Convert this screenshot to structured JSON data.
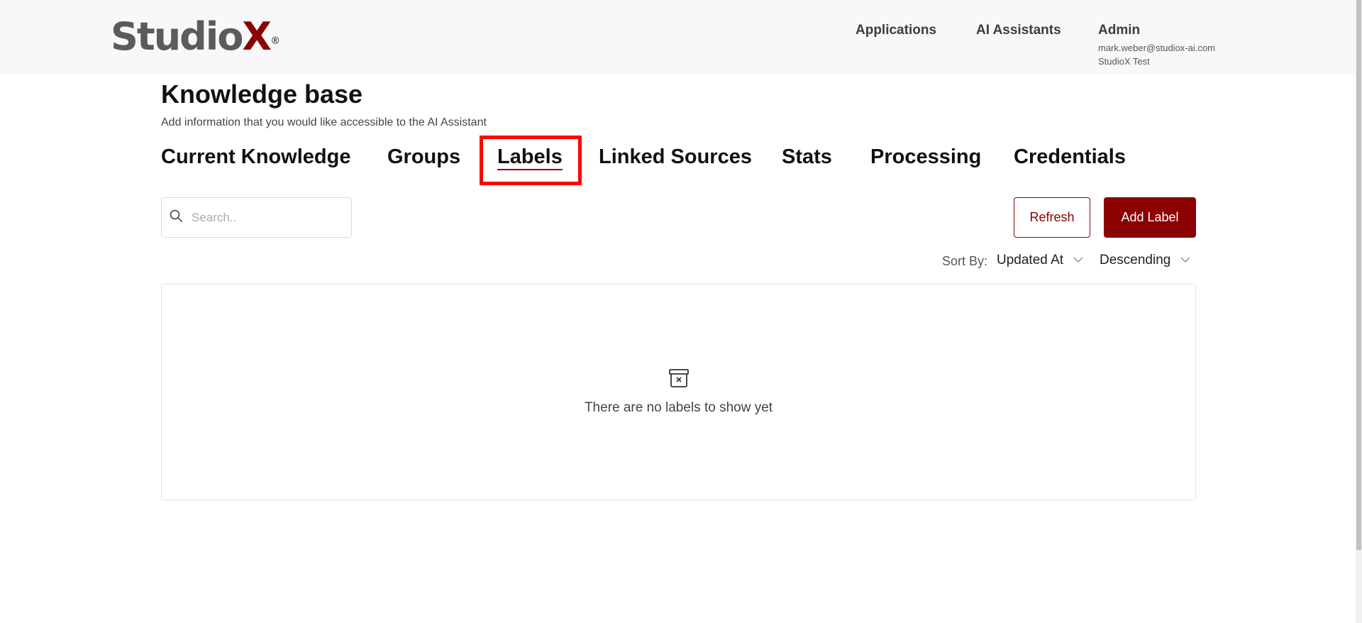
{
  "header": {
    "logo_text": "StudioX",
    "nav": [
      "Applications",
      "AI Assistants"
    ],
    "user": {
      "name": "Admin",
      "email": "mark.weber@studiox-ai.com",
      "org": "StudioX Test"
    }
  },
  "page": {
    "title": "Knowledge base",
    "subtitle": "Add information that you would like accessible to the AI Assistant"
  },
  "tabs": [
    {
      "label": "Current Knowledge",
      "active": false
    },
    {
      "label": "Groups",
      "active": false
    },
    {
      "label": "Labels",
      "active": true
    },
    {
      "label": "Linked Sources",
      "active": false
    },
    {
      "label": "Stats",
      "active": false
    },
    {
      "label": "Processing",
      "active": false
    },
    {
      "label": "Credentials",
      "active": false
    }
  ],
  "toolbar": {
    "search_placeholder": "Search..",
    "refresh_label": "Refresh",
    "add_label": "Add Label"
  },
  "sort": {
    "label": "Sort By:",
    "field": "Updated At",
    "order": "Descending"
  },
  "empty_state": {
    "icon": "archive-x-icon",
    "message": "There are no labels to show yet"
  },
  "colors": {
    "brand": "#8b0000",
    "highlight": "#ff0000",
    "topbar_bg": "#f8f8fa"
  }
}
